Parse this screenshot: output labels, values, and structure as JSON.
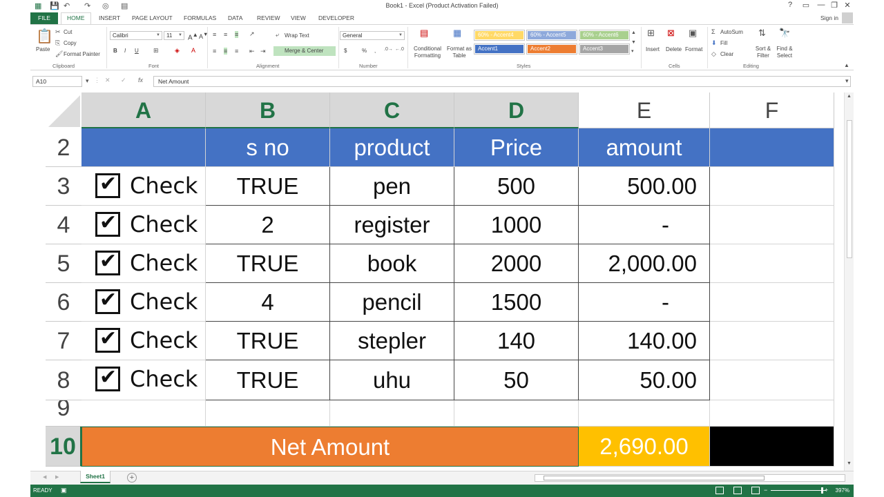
{
  "window": {
    "title": "Book1 - Excel (Product Activation Failed)",
    "help": "?",
    "minimize": "—",
    "restore": "❐",
    "close": "✕"
  },
  "tabs": {
    "file": "FILE",
    "items": [
      "HOME",
      "INSERT",
      "PAGE LAYOUT",
      "FORMULAS",
      "DATA",
      "REVIEW",
      "VIEW",
      "DEVELOPER"
    ],
    "signin": "Sign in"
  },
  "ribbon": {
    "clipboard": {
      "paste": "Paste",
      "cut": "Cut",
      "copy": "Copy",
      "format_painter": "Format Painter",
      "label": "Clipboard"
    },
    "font": {
      "name": "Calibri",
      "size": "11",
      "bold": "B",
      "italic": "I",
      "underline": "U",
      "label": "Font"
    },
    "alignment": {
      "wrap_text": "Wrap Text",
      "merge_center": "Merge & Center",
      "label": "Alignment"
    },
    "number": {
      "format": "General",
      "currency": "$",
      "percent": "%",
      "comma": ",",
      "label": "Number"
    },
    "styles": {
      "conditional": "Conditional Formatting",
      "format_as_table": "Format as Table",
      "boxes": [
        {
          "text": "60% - Accent4",
          "color": "#ffd966"
        },
        {
          "text": "60% - Accent5",
          "color": "#8ea9db"
        },
        {
          "text": "60% - Accent6",
          "color": "#a9d08e"
        },
        {
          "text": "Accent1",
          "color": "#4472c4"
        },
        {
          "text": "Accent2",
          "color": "#ed7d31"
        },
        {
          "text": "Accent3",
          "color": "#a5a5a5"
        }
      ],
      "label": "Styles"
    },
    "cells": {
      "insert": "Insert",
      "delete": "Delete",
      "format": "Format",
      "label": "Cells"
    },
    "editing": {
      "autosum": "AutoSum",
      "fill": "Fill",
      "clear": "Clear",
      "sort_filter": "Sort & Filter",
      "find_select": "Find & Select",
      "label": "Editing"
    }
  },
  "formula_bar": {
    "name_box": "A10",
    "fx": "fx",
    "cancel": "✕",
    "enter": "✓",
    "value": "Net Amount"
  },
  "grid": {
    "columns": [
      "A",
      "B",
      "C",
      "D",
      "E",
      "F"
    ],
    "header_row": {
      "num": "2",
      "cells": [
        "",
        "s no",
        "product",
        "Price",
        "amount",
        ""
      ]
    },
    "rows": [
      {
        "num": "3",
        "check": "Check",
        "sno": "TRUE",
        "product": "pen",
        "price": "500",
        "amount": "500.00"
      },
      {
        "num": "4",
        "check": "Check",
        "sno": "2",
        "product": "register",
        "price": "1000",
        "amount": "-"
      },
      {
        "num": "5",
        "check": "Check",
        "sno": "TRUE",
        "product": "book",
        "price": "2000",
        "amount": "2,000.00"
      },
      {
        "num": "6",
        "check": "Check",
        "sno": "4",
        "product": "pencil",
        "price": "1500",
        "amount": "-"
      },
      {
        "num": "7",
        "check": "Check",
        "sno": "TRUE",
        "product": "stepler",
        "price": "140",
        "amount": "140.00"
      },
      {
        "num": "8",
        "check": "Check",
        "sno": "TRUE",
        "product": "uhu",
        "price": "50",
        "amount": "50.00"
      }
    ],
    "row9": "9",
    "row10": {
      "num": "10",
      "label": "Net Amount",
      "total": "2,690.00"
    }
  },
  "sheets": {
    "active": "Sheet1",
    "add": "+"
  },
  "status": {
    "ready": "READY",
    "zoom": "397%"
  }
}
